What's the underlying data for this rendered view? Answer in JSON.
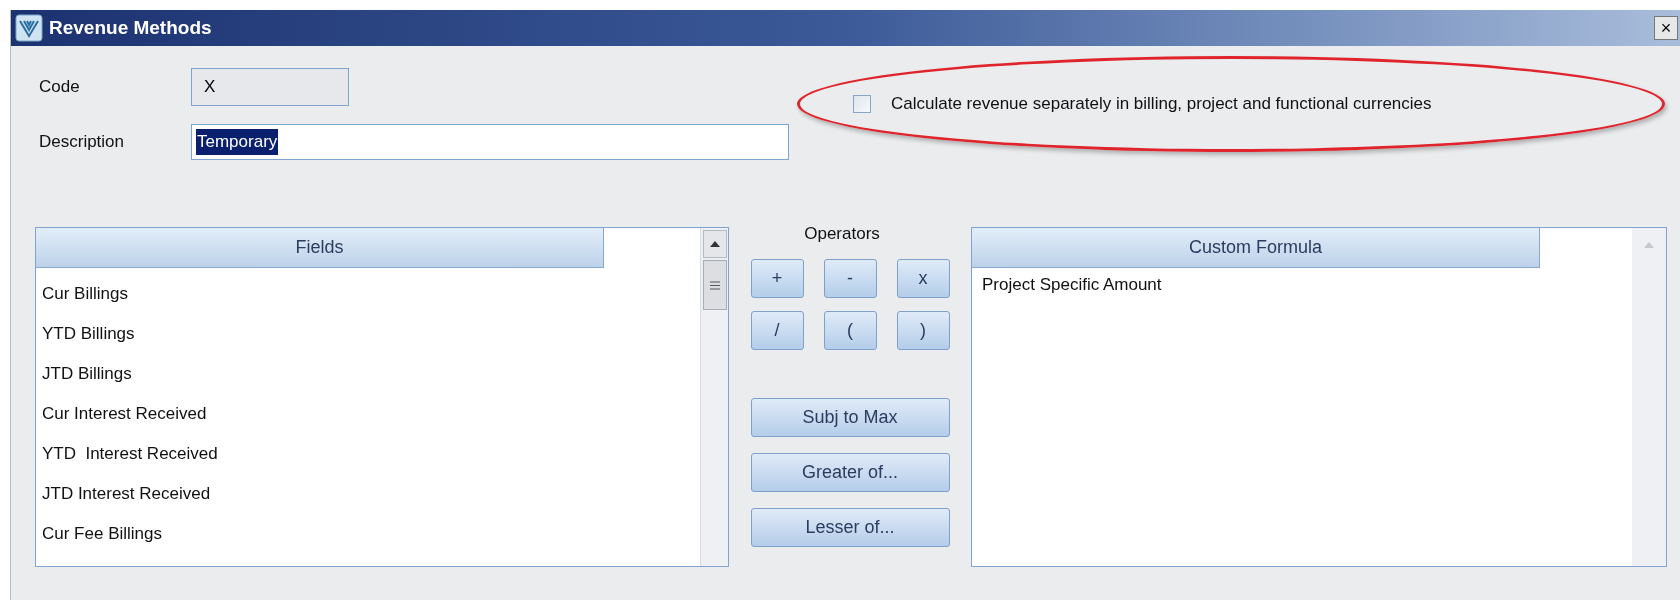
{
  "window": {
    "title": "Revenue Methods",
    "close": "×"
  },
  "code": {
    "label": "Code",
    "value": "X"
  },
  "description": {
    "label": "Description",
    "value": "Temporary",
    "text_selected": true
  },
  "separate_currencies": {
    "label": "Calculate revenue separately in billing, project and functional currencies",
    "checked": false
  },
  "fields": {
    "header": "Fields",
    "items": [
      {
        "label": "Cur Billings"
      },
      {
        "label": "YTD Billings"
      },
      {
        "label": "JTD Billings"
      },
      {
        "label": "Cur Interest Received"
      },
      {
        "label": "YTD  Interest Received"
      },
      {
        "label": "JTD Interest Received"
      },
      {
        "label": "Cur Fee Billings"
      }
    ]
  },
  "operators": {
    "label": "Operators",
    "symbols": [
      "+",
      "-",
      "x",
      "/",
      "(",
      ")"
    ],
    "functions": [
      "Subj to Max",
      "Greater of...",
      "Lesser of..."
    ]
  },
  "custom_formula": {
    "header": "Custom Formula",
    "text": "Project Specific Amount"
  }
}
